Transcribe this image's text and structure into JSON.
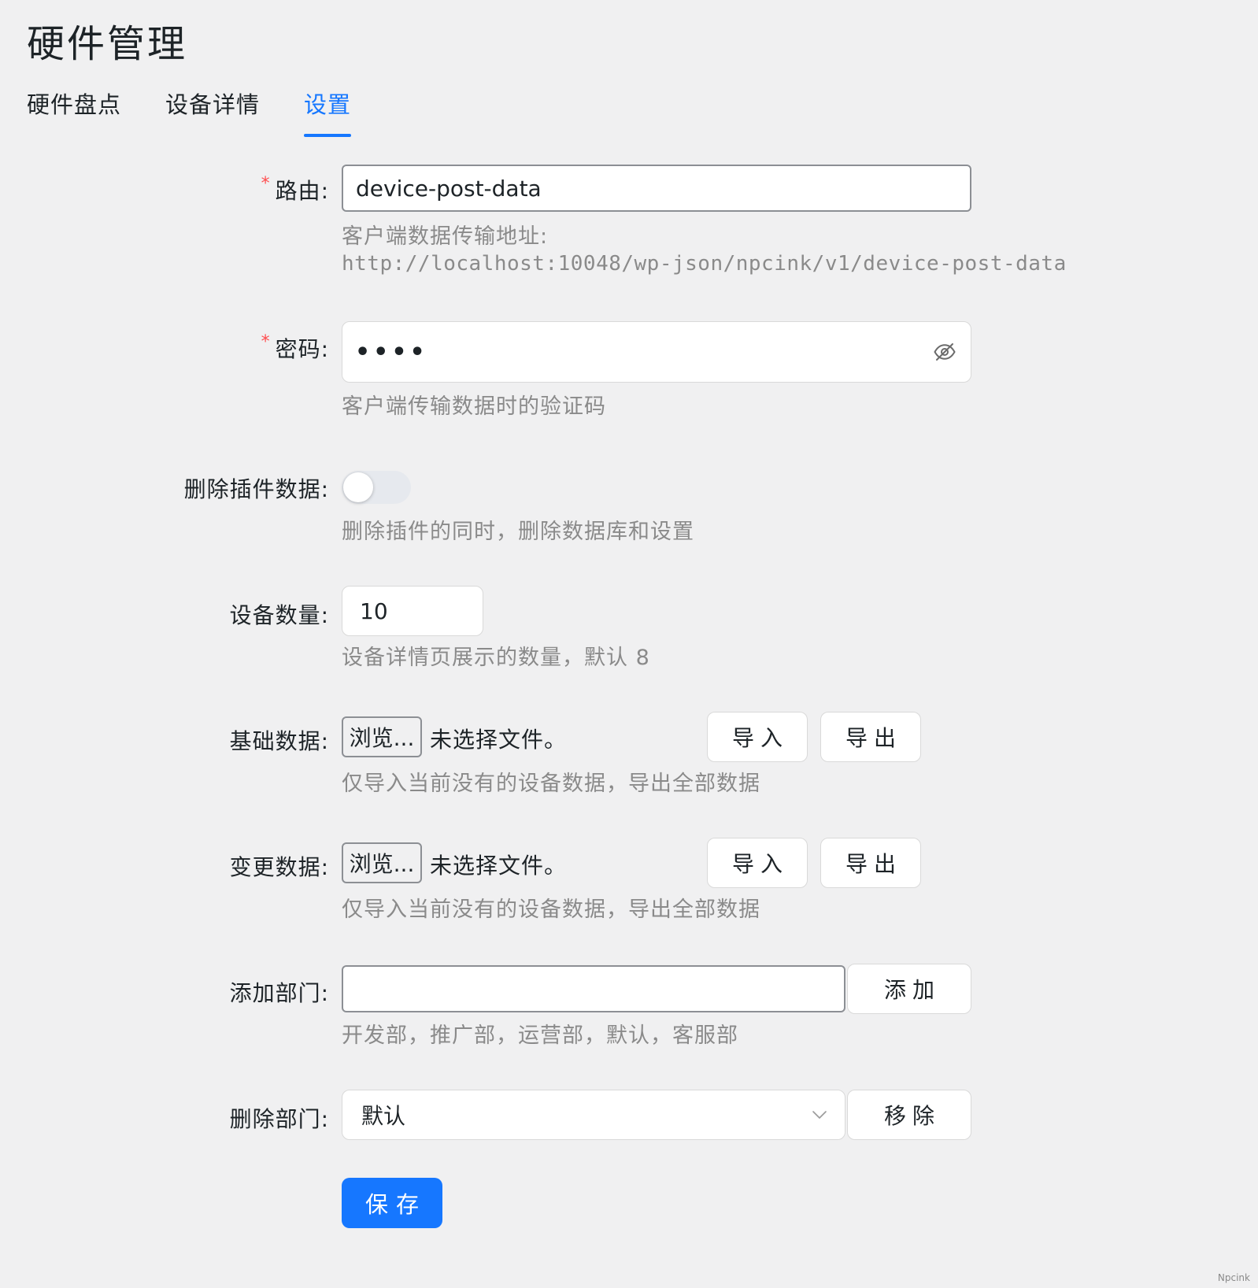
{
  "page": {
    "title": "硬件管理"
  },
  "tabs": [
    {
      "label": "硬件盘点",
      "active": false
    },
    {
      "label": "设备详情",
      "active": false
    },
    {
      "label": "设置",
      "active": true
    }
  ],
  "form": {
    "route": {
      "label": "路由:",
      "required": "*",
      "value": "device-post-data",
      "help_line1": "客户端数据传输地址:",
      "help_line2": "http://localhost:10048/wp-json/npcink/v1/device-post-data"
    },
    "password": {
      "label": "密码:",
      "required": "*",
      "masked_value": "••••",
      "help": "客户端传输数据时的验证码"
    },
    "delete_plugin_data": {
      "label": "删除插件数据:",
      "enabled": false,
      "help": "删除插件的同时，删除数据库和设置"
    },
    "device_count": {
      "label": "设备数量:",
      "value": "10",
      "help": "设备详情页展示的数量，默认 8"
    },
    "base_data": {
      "label": "基础数据:",
      "browse_label": "浏览...",
      "no_file": "未选择文件。",
      "import_label": "导入",
      "export_label": "导出",
      "help": "仅导入当前没有的设备数据，导出全部数据"
    },
    "change_data": {
      "label": "变更数据:",
      "browse_label": "浏览...",
      "no_file": "未选择文件。",
      "import_label": "导入",
      "export_label": "导出",
      "help": "仅导入当前没有的设备数据，导出全部数据"
    },
    "add_department": {
      "label": "添加部门:",
      "value": "",
      "button_label": "添加",
      "help": "开发部，推广部，运营部，默认，客服部"
    },
    "delete_department": {
      "label": "删除部门:",
      "selected": "默认",
      "button_label": "移除"
    },
    "save_label": "保存"
  },
  "colors": {
    "accent": "#1677ff",
    "required": "#ff4d4f",
    "help_text": "#8a8a8a",
    "background": "#f0f0f1"
  },
  "icons": {
    "password_toggle": "eye-off-icon",
    "select_arrow": "chevron-down-icon"
  },
  "watermark": "Npcink"
}
